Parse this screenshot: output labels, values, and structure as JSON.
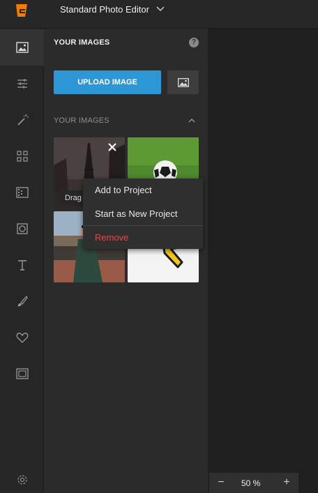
{
  "app": {
    "title": "Standard Photo Editor"
  },
  "toolrail": {
    "items": [
      {
        "icon": "image-icon",
        "active": true
      },
      {
        "icon": "sliders-icon"
      },
      {
        "icon": "magic-wand-icon"
      },
      {
        "icon": "grid-icon"
      },
      {
        "icon": "texture-icon"
      },
      {
        "icon": "frame-icon"
      },
      {
        "icon": "text-icon"
      },
      {
        "icon": "brush-icon"
      },
      {
        "icon": "heart-icon"
      },
      {
        "icon": "border-icon"
      },
      {
        "icon": "gear-icon"
      }
    ]
  },
  "panel": {
    "heading": "YOUR IMAGES",
    "upload_label": "UPLOAD IMAGE",
    "section_heading": "YOUR IMAGES",
    "drag_label": "Drag"
  },
  "context_menu": {
    "items": [
      "Add to Project",
      "Start as New Project",
      "Remove"
    ]
  },
  "zoom": {
    "minus": "−",
    "value": "50 %",
    "plus": "+"
  },
  "colors": {
    "accent": "#2c97d4",
    "remove": "#e64848",
    "logo": "#f57c00"
  }
}
